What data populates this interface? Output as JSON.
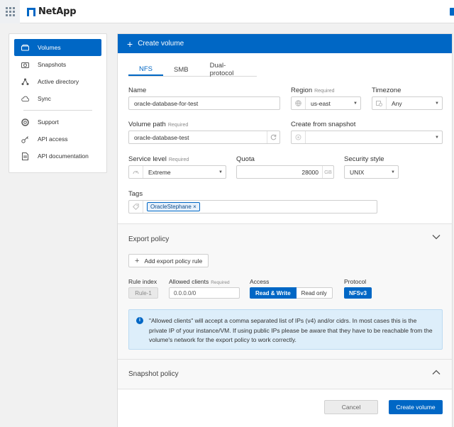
{
  "app": {
    "brand": "NetApp",
    "brand_icon": "netapp-logo",
    "apps_icon": "apps-grid-icon"
  },
  "sidebar": {
    "items": [
      {
        "label": "Volumes",
        "icon": "volume-icon",
        "active": true
      },
      {
        "label": "Snapshots",
        "icon": "camera-icon",
        "active": false
      },
      {
        "label": "Active directory",
        "icon": "network-icon",
        "active": false
      },
      {
        "label": "Sync",
        "icon": "cloud-sync-icon",
        "active": false
      }
    ],
    "items2": [
      {
        "label": "Support",
        "icon": "lifebuoy-icon"
      },
      {
        "label": "API access",
        "icon": "key-icon"
      },
      {
        "label": "API documentation",
        "icon": "document-icon"
      }
    ]
  },
  "panel": {
    "title": "Create volume",
    "tabs": [
      "NFS",
      "SMB",
      "Dual-protocol"
    ],
    "name": {
      "label": "Name",
      "value": "oracle-database-for-test"
    },
    "region": {
      "label": "Region",
      "required": "Required",
      "value": "us-east"
    },
    "timezone": {
      "label": "Timezone",
      "value": "Any"
    },
    "volume_path": {
      "label": "Volume path",
      "required": "Required",
      "value": "oracle-database-test"
    },
    "snapshot": {
      "label": "Create from snapshot",
      "value": ""
    },
    "service_level": {
      "label": "Service level",
      "required": "Required",
      "value": "Extreme"
    },
    "quota": {
      "label": "Quota",
      "value": "28000",
      "unit": "GB"
    },
    "security": {
      "label": "Security style",
      "value": "UNIX"
    },
    "tags": {
      "label": "Tags",
      "chip": "OracleStephane",
      "chip_remove": "×"
    },
    "export": {
      "title": "Export policy",
      "add_rule": "Add export policy rule",
      "rule_index_label": "Rule index",
      "allowed_label": "Allowed clients",
      "allowed_required": "Required",
      "access_label": "Access",
      "protocol_label": "Protocol",
      "rule_index": "Rule-1",
      "allowed_value": "0.0.0.0/0",
      "access_rw": "Read & Write",
      "access_ro": "Read only",
      "protocol": "NFSv3",
      "info": "\"Allowed clients\" will accept a comma separated list of IPs (v4) and/or cidrs. In most cases this is the private IP of your instance/VM. If using public IPs please be aware that they have to be reachable from the volume's network for the export policy to work correctly."
    },
    "snapshot_policy": {
      "title": "Snapshot policy"
    },
    "cancel": "Cancel",
    "create": "Create volume"
  }
}
